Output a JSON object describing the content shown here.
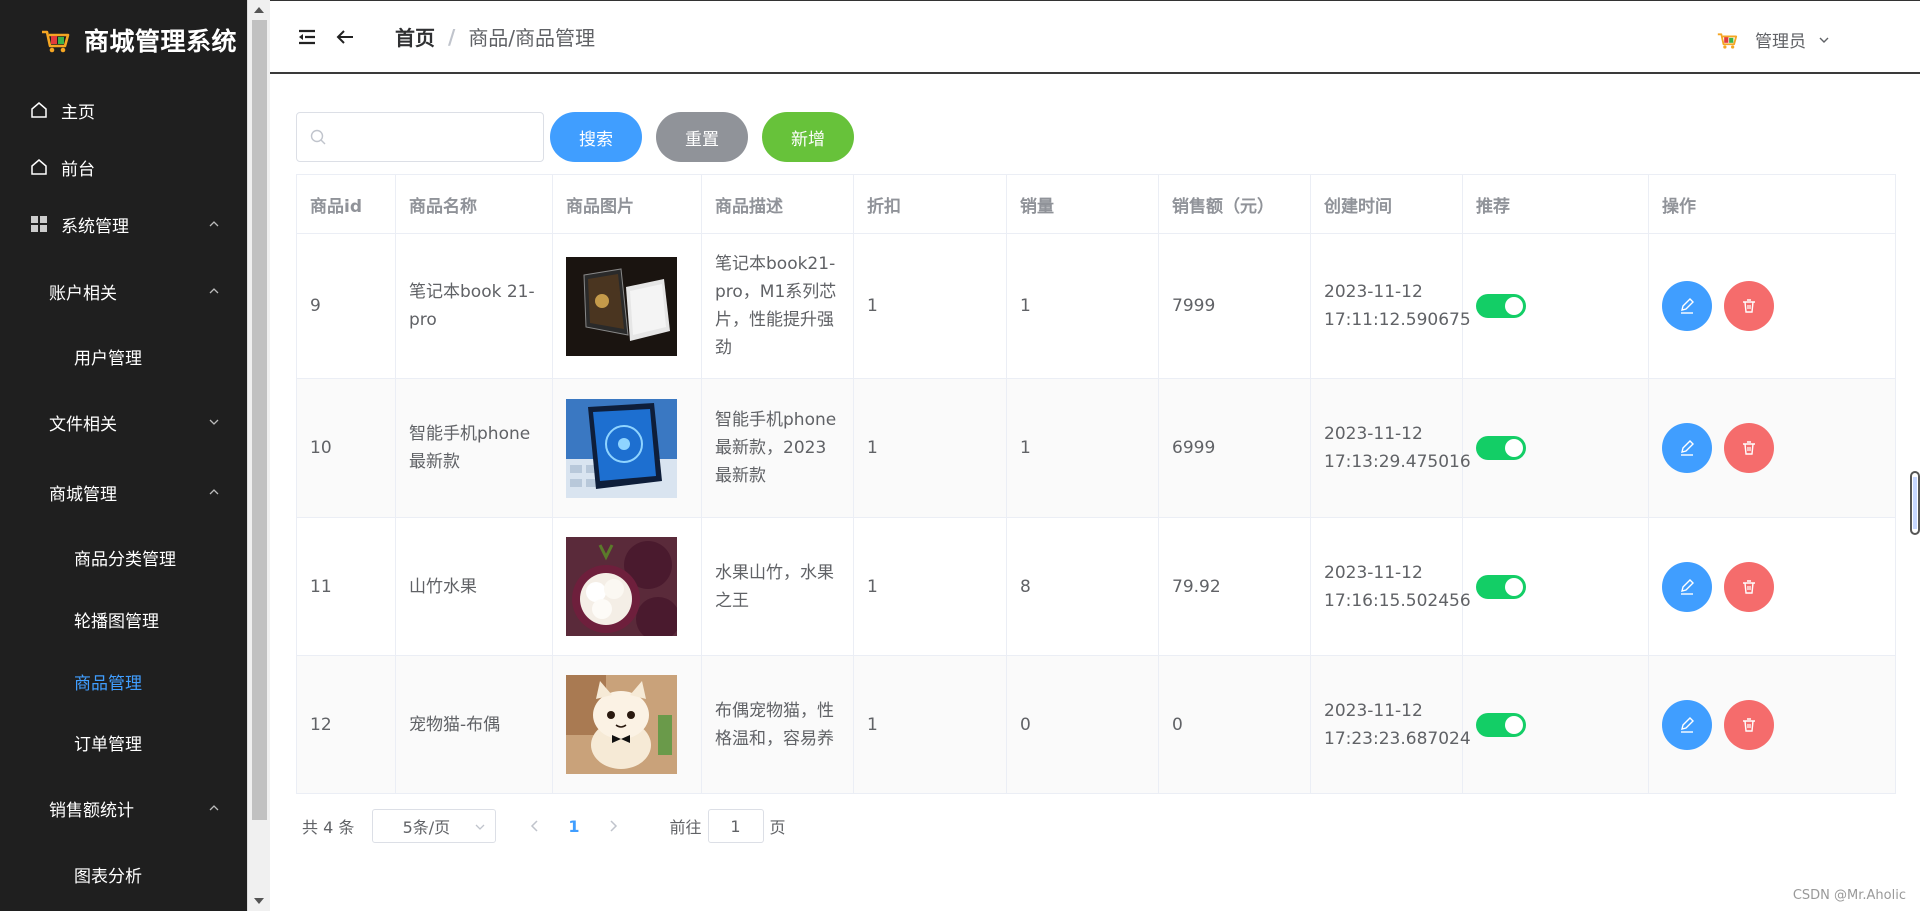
{
  "app": {
    "title": "商城管理系统"
  },
  "sidebar": {
    "items": [
      {
        "label": "主页"
      },
      {
        "label": "前台"
      },
      {
        "label": "系统管理"
      },
      {
        "label": "账户相关"
      },
      {
        "label": "用户管理"
      },
      {
        "label": "文件相关"
      },
      {
        "label": "商城管理"
      },
      {
        "label": "商品分类管理"
      },
      {
        "label": "轮播图管理"
      },
      {
        "label": "商品管理"
      },
      {
        "label": "订单管理"
      },
      {
        "label": "销售额统计"
      },
      {
        "label": "图表分析"
      }
    ]
  },
  "header": {
    "breadcrumb_home": "首页",
    "breadcrumb_sep": "/",
    "breadcrumb_current": "商品/商品管理",
    "user": "管理员"
  },
  "toolbar": {
    "search_placeholder": "",
    "search_label": "搜索",
    "reset_label": "重置",
    "add_label": "新增"
  },
  "table": {
    "columns": [
      "商品id",
      "商品名称",
      "商品图片",
      "商品描述",
      "折扣",
      "销量",
      "销售额（元）",
      "创建时间",
      "推荐",
      "操作"
    ],
    "rows": [
      {
        "id": "9",
        "name": "笔记本book 21-pro",
        "desc": "笔记本book21-pro，M1系列芯片，性能提升强劲",
        "discount": "1",
        "sales": "1",
        "revenue": "7999",
        "created": "2023-11-12 17:11:12.590675",
        "recommend": true,
        "image": "laptop"
      },
      {
        "id": "10",
        "name": "智能手机phone最新款",
        "desc": "智能手机phone最新款，2023最新款",
        "discount": "1",
        "sales": "1",
        "revenue": "6999",
        "created": "2023-11-12 17:13:29.475016",
        "recommend": true,
        "image": "phone"
      },
      {
        "id": "11",
        "name": "山竹水果",
        "desc": "水果山竹，水果之王",
        "discount": "1",
        "sales": "8",
        "revenue": "79.92",
        "created": "2023-11-12 17:16:15.502456",
        "recommend": true,
        "image": "mangosteen"
      },
      {
        "id": "12",
        "name": "宠物猫-布偶",
        "desc": "布偶宠物猫，性格温和，容易养",
        "discount": "1",
        "sales": "0",
        "revenue": "0",
        "created": "2023-11-12 17:23:23.687024",
        "recommend": true,
        "image": "cat-doll"
      }
    ]
  },
  "pager": {
    "total": "共 4 条",
    "page_size": "5条/页",
    "current_page": "1",
    "goto_prefix": "前往",
    "goto_value": "1",
    "goto_suffix": "页"
  },
  "watermark": "CSDN @Mr.Aholic",
  "colors": {
    "primary": "#409eff",
    "success": "#67c23a",
    "info": "#909399",
    "danger": "#f56c6c",
    "switch_on": "#13ce66",
    "sidebar_bg": "#1f1f1f"
  }
}
